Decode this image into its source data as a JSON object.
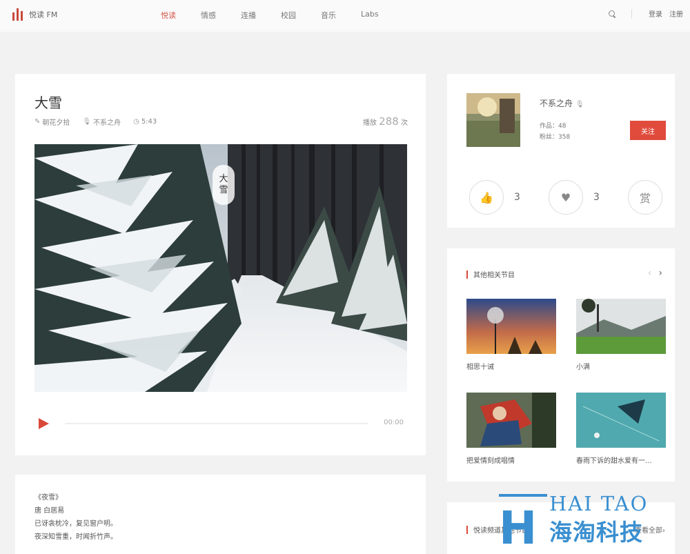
{
  "header": {
    "logo_text": "悦读 FM",
    "nav": [
      {
        "label": "悦读",
        "active": true
      },
      {
        "label": "情感",
        "active": false
      },
      {
        "label": "连播",
        "active": false
      },
      {
        "label": "校园",
        "active": false
      },
      {
        "label": "音乐",
        "active": false
      },
      {
        "label": "Labs",
        "active": false
      }
    ],
    "login_label": "登录",
    "register_label": "注册"
  },
  "track": {
    "title": "大雪",
    "editor": "朝花夕拾",
    "anchor": "不系之舟",
    "duration": "5:43",
    "plays_prefix": "播放",
    "plays_count": "288",
    "plays_suffix": "次",
    "cover_label_chars": [
      "大",
      "雪"
    ],
    "player_time": "00:00"
  },
  "lyrics": [
    "《夜雪》",
    "唐 白居易",
    "已讶衾枕冷，复见窗户明。",
    "夜深知雪重，时闻折竹声。"
  ],
  "author": {
    "name": "不系之舟",
    "works_label": "作品：48",
    "fans_label": "粉丝：358",
    "follow_label": "关注"
  },
  "actions": {
    "like_count": "3",
    "favorite_count": "3",
    "reward_label": "赏"
  },
  "related": {
    "title": "其他相关节目",
    "items": [
      {
        "title": "相思十诫"
      },
      {
        "title": "小满"
      },
      {
        "title": "把爱情刻成唱情"
      },
      {
        "title": "春雨下诉的甜水爱有一..."
      }
    ]
  },
  "more": {
    "title": "悦读频道其他节目",
    "link": "查看全部›"
  },
  "watermark": {
    "letter": "H",
    "english": "HAI TAO",
    "chinese": "海淘科技"
  },
  "colors": {
    "accent": "#d9493a",
    "follow_button": "#e04b3c",
    "watermark": "#3a8fd0",
    "page_background": "#f2f2f2"
  }
}
